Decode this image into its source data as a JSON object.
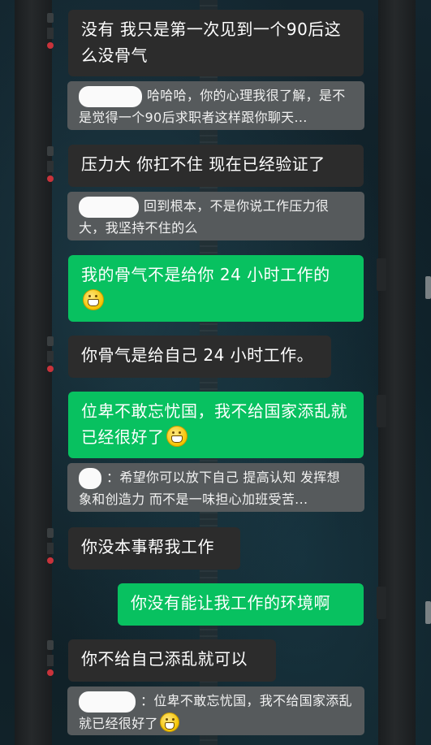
{
  "messages": [
    {
      "role": "received",
      "text": "没有 我只是第一次见到一个90后这么没骨气"
    },
    {
      "role": "quote",
      "text": "哈哈哈，你的心理我很了解，是不是觉得一个90后求职者这样跟你聊天..."
    },
    {
      "role": "received",
      "text": "压力大 你扛不住  现在已经验证了"
    },
    {
      "role": "quote",
      "text": "回到根本，不是你说工作压力很大，我坚持不住的么"
    },
    {
      "role": "sent",
      "text": "我的骨气不是给你 24 小时工作的",
      "emoji": "grin-emoji"
    },
    {
      "role": "received",
      "text": "你骨气是给自己 24 小时工作。"
    },
    {
      "role": "sent",
      "text": "位卑不敢忘忧国，我不给国家添乱就已经很好了",
      "emoji": "grin-emoji"
    },
    {
      "role": "quote",
      "text": "希望你可以放下自己 提高认知 发挥想象和创造力  而不是一味担心加班受苦..."
    },
    {
      "role": "received",
      "text": "你没本事帮我工作"
    },
    {
      "role": "sent",
      "text": "你没有能让我工作的环境啊"
    },
    {
      "role": "received",
      "text": "你不给自己添乱就可以"
    },
    {
      "role": "quote",
      "text": "位卑不敢忘忧国，我不给国家添乱就已经很好了",
      "emoji": "grin-emoji"
    }
  ],
  "quote_prefixes": {
    "m1": "",
    "m3": "",
    "m7": "：",
    "m11": "："
  },
  "colors": {
    "sent_bubble": "#08c160",
    "received_bubble": "#2c2c2c",
    "quote_bg": "#565a5c"
  }
}
